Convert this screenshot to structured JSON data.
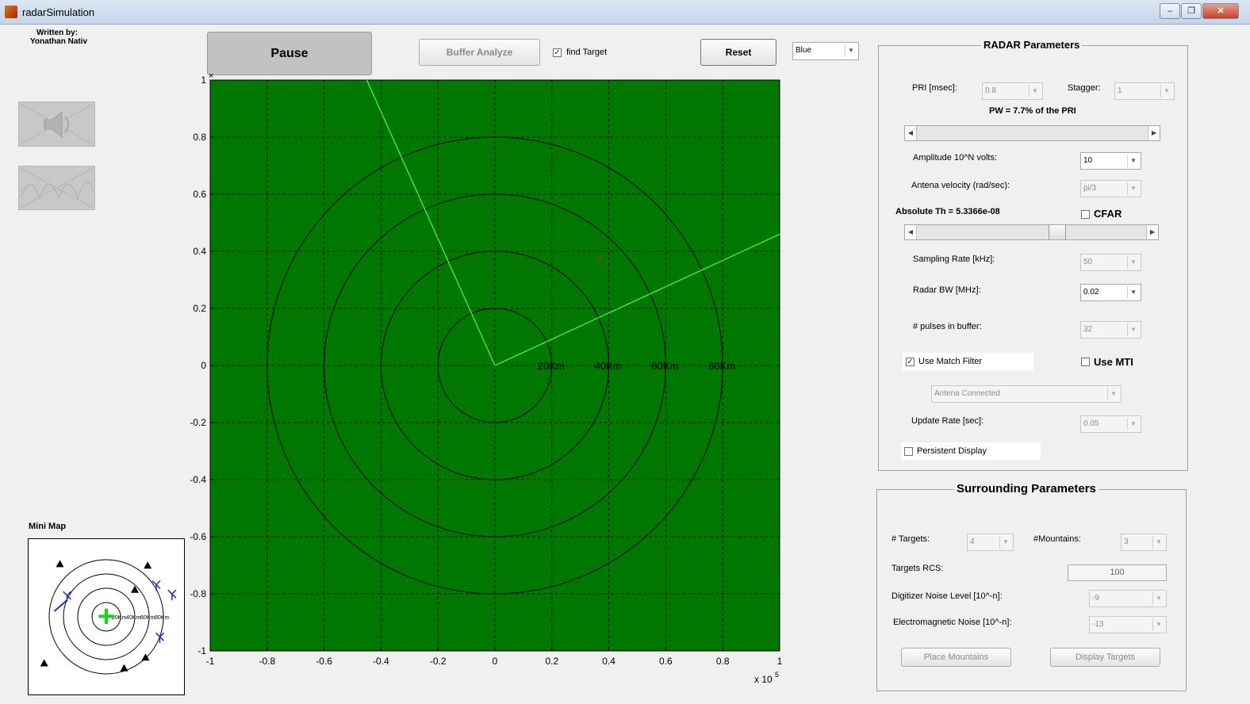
{
  "window": {
    "title": "radarSimulation",
    "minimize": "–",
    "restore": "❐",
    "close": "✕"
  },
  "author": {
    "line1": "Written by:",
    "line2": "Yonathan Nativ"
  },
  "left_icons": {
    "speaker": "speaker-muted-icon",
    "signal": "signal-off-icon"
  },
  "toolbar": {
    "pause_label": "Pause",
    "buffer_analyze_label": "Buffer Analyze",
    "find_target_label": "find Target",
    "find_target_checked": true,
    "reset_label": "Reset",
    "color_select_value": "Blue"
  },
  "radar_plot": {
    "background": "#007800",
    "x_ticks": [
      "-1",
      "-0.8",
      "-0.6",
      "-0.4",
      "-0.2",
      "0",
      "0.2",
      "0.4",
      "0.6",
      "0.8",
      "1"
    ],
    "y_ticks": [
      "1",
      "0.8",
      "0.6",
      "0.4",
      "0.2",
      "0",
      "-0.2",
      "-0.4",
      "-0.6",
      "-0.8",
      "-1"
    ],
    "x_multiplier_base": "x 10",
    "x_multiplier_exp": "5",
    "ring_labels": [
      "20Km",
      "40Km",
      "60Km",
      "80Km"
    ],
    "ring_radii": [
      0.2,
      0.4,
      0.6,
      0.8
    ],
    "sweep_lines": [
      [
        -0.45,
        1.0
      ],
      [
        1.0,
        0.46
      ]
    ],
    "target": [
      0.375,
      0.37
    ],
    "target_color": "#d02020",
    "sweep_color": "#40ff40",
    "origin_marker": "×"
  },
  "minimap": {
    "title": "Mini Map",
    "ring_labels": [
      "20Km",
      "40Km",
      "60Km",
      "80Km"
    ],
    "center_marker": "+",
    "mountains": [
      [
        -0.65,
        0.74
      ],
      [
        0.58,
        0.72
      ],
      [
        0.4,
        0.38
      ],
      [
        -0.87,
        -0.65
      ],
      [
        0.25,
        -0.72
      ],
      [
        0.55,
        -0.57
      ]
    ],
    "targets": [
      [
        -0.55,
        0.3
      ],
      [
        0.92,
        0.32
      ],
      [
        0.7,
        0.45
      ],
      [
        0.75,
        -0.28
      ]
    ]
  },
  "radar_params": {
    "title": "RADAR Parameters",
    "pri_label": "PRI [msec]:",
    "pri_value": "0.8",
    "stagger_label": "Stagger:",
    "stagger_value": "1",
    "pw_text": "PW = 7.7% of the PRI",
    "pw_slider_fraction": 0.0,
    "amplitude_label": "Amplitude 10^N volts:",
    "amplitude_value": "10",
    "antenna_velocity_label": "Antena velocity (rad/sec):",
    "antenna_velocity_value": "pi/3",
    "absolute_th_text": "Absolute Th = 5.3366e-08",
    "cfar_label": "CFAR",
    "cfar_checked": false,
    "th_slider_fraction": 0.62,
    "sampling_rate_label": "Sampling Rate [kHz]:",
    "sampling_rate_value": "50",
    "radar_bw_label": "Radar BW [MHz]:",
    "radar_bw_value": "0.02",
    "pulses_label": "# pulses in buffer:",
    "pulses_value": "32",
    "match_filter_label": "Use Match Filter",
    "match_filter_checked": true,
    "mti_label": "Use MTI",
    "mti_checked": false,
    "antenna_mode_value": "Antena Connected",
    "update_rate_label": "Update Rate [sec]:",
    "update_rate_value": "0.05",
    "persistent_label": "Persistent Display",
    "persistent_checked": false
  },
  "surrounding_params": {
    "title": "Surrounding Parameters",
    "targets_label": "# Targets:",
    "targets_value": "4",
    "mountains_label": "#Mountains:",
    "mountains_value": "3",
    "rcs_label": "Targets RCS:",
    "rcs_value": "100",
    "digitizer_label": "Digitizer Noise Level [10^-n]:",
    "digitizer_value": "-9",
    "em_noise_label": "Electromagnetic Noise [10^-n]:",
    "em_noise_value": "-13",
    "place_mountains_label": "Place Mountains",
    "display_targets_label": "Display Targets"
  },
  "check_mark": "✓",
  "dropdown_arrow": "▼",
  "slider_left_arrow": "◀",
  "slider_right_arrow": "▶"
}
